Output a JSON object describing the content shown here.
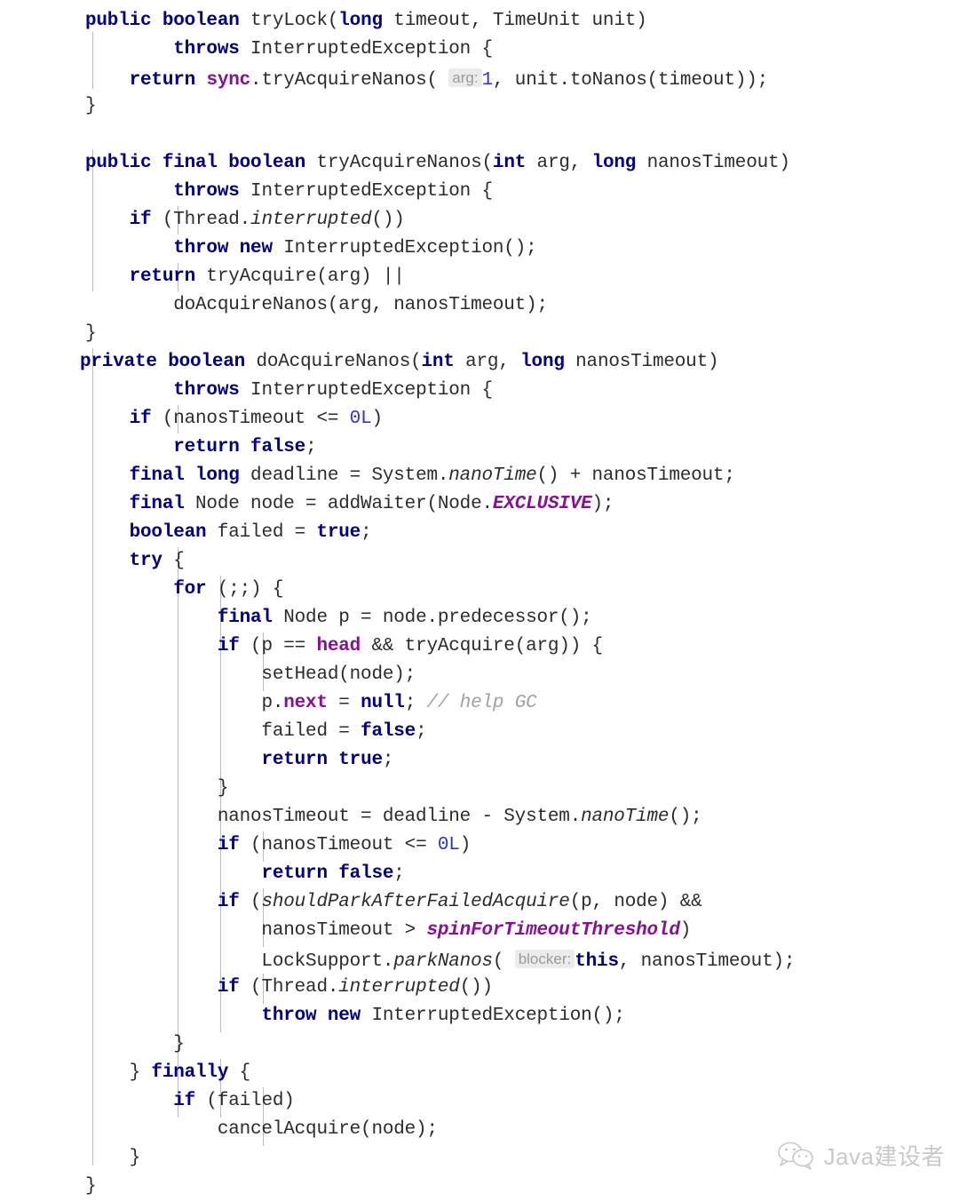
{
  "editor": {
    "language": "java",
    "background": "#ffffff",
    "default_text_color": "#2b2b2b",
    "colors": {
      "keyword": "#000080",
      "number": "#3232cd",
      "field": "#871094",
      "static_field": "#871094",
      "comment": "#a0a0a0",
      "hint_background": "#ebebeb",
      "hint_text": "#9a9a9a",
      "indent_guide": "#b8b8c0"
    },
    "lines": [
      {
        "indent": 0,
        "text": "public boolean tryLock(long timeout, TimeUnit unit)"
      },
      {
        "indent": 2,
        "text": "        throws InterruptedException {"
      },
      {
        "indent": 1,
        "text": "    return sync.tryAcquireNanos( arg: 1, unit.toNanos(timeout));"
      },
      {
        "indent": 0,
        "text": "}"
      },
      {
        "indent": 0,
        "text": ""
      },
      {
        "indent": 0,
        "text": "public final boolean tryAcquireNanos(int arg, long nanosTimeout)"
      },
      {
        "indent": 2,
        "text": "        throws InterruptedException {"
      },
      {
        "indent": 1,
        "text": "    if (Thread.interrupted())"
      },
      {
        "indent": 2,
        "text": "        throw new InterruptedException();"
      },
      {
        "indent": 1,
        "text": "    return tryAcquire(arg) ||"
      },
      {
        "indent": 2,
        "text": "        doAcquireNanos(arg, nanosTimeout);"
      },
      {
        "indent": 0,
        "text": "}"
      },
      {
        "indent": 0,
        "text": "private boolean doAcquireNanos(int arg, long nanosTimeout)"
      },
      {
        "indent": 2,
        "text": "        throws InterruptedException {"
      },
      {
        "indent": 1,
        "text": "    if (nanosTimeout <= 0L)"
      },
      {
        "indent": 2,
        "text": "        return false;"
      },
      {
        "indent": 1,
        "text": "    final long deadline = System.nanoTime() + nanosTimeout;"
      },
      {
        "indent": 1,
        "text": "    final Node node = addWaiter(Node.EXCLUSIVE);"
      },
      {
        "indent": 1,
        "text": "    boolean failed = true;"
      },
      {
        "indent": 1,
        "text": "    try {"
      },
      {
        "indent": 2,
        "text": "        for (;;) {"
      },
      {
        "indent": 3,
        "text": "            final Node p = node.predecessor();"
      },
      {
        "indent": 3,
        "text": "            if (p == head && tryAcquire(arg)) {"
      },
      {
        "indent": 4,
        "text": "                setHead(node);"
      },
      {
        "indent": 4,
        "text": "                p.next = null; // help GC"
      },
      {
        "indent": 4,
        "text": "                failed = false;"
      },
      {
        "indent": 4,
        "text": "                return true;"
      },
      {
        "indent": 3,
        "text": "            }"
      },
      {
        "indent": 3,
        "text": "            nanosTimeout = deadline - System.nanoTime();"
      },
      {
        "indent": 3,
        "text": "            if (nanosTimeout <= 0L)"
      },
      {
        "indent": 4,
        "text": "                return false;"
      },
      {
        "indent": 3,
        "text": "            if (shouldParkAfterFailedAcquire(p, node) &&"
      },
      {
        "indent": 4,
        "text": "                nanosTimeout > spinForTimeoutThreshold)"
      },
      {
        "indent": 4,
        "text": "                LockSupport.parkNanos( blocker: this, nanosTimeout);"
      },
      {
        "indent": 3,
        "text": "            if (Thread.interrupted())"
      },
      {
        "indent": 4,
        "text": "                throw new InterruptedException();"
      },
      {
        "indent": 2,
        "text": "        }"
      },
      {
        "indent": 1,
        "text": "    } finally {"
      },
      {
        "indent": 2,
        "text": "        if (failed)"
      },
      {
        "indent": 3,
        "text": "            cancelAcquire(node);"
      },
      {
        "indent": 1,
        "text": "    }"
      },
      {
        "indent": 0,
        "text": "}"
      }
    ],
    "inlay_hints": [
      {
        "label": "arg:",
        "value": "1",
        "line": 2
      },
      {
        "label": "blocker:",
        "value": "this",
        "line": 33
      }
    ]
  },
  "watermark": {
    "icon": "wechat-icon",
    "text": "Java建设者"
  }
}
